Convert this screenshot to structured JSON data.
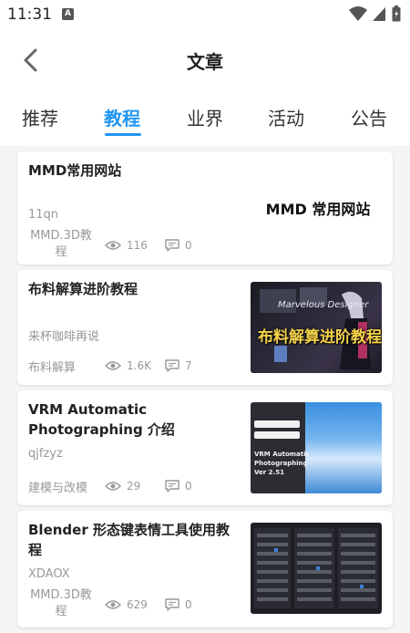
{
  "statusbar": {
    "time": "11:31",
    "notif_letter": "A"
  },
  "header": {
    "title": "文章"
  },
  "tabs": [
    {
      "label": "推荐"
    },
    {
      "label": "教程"
    },
    {
      "label": "业界"
    },
    {
      "label": "活动"
    },
    {
      "label": "公告"
    }
  ],
  "active_tab": "教程",
  "colors": {
    "accent": "#2196f3",
    "muted": "#999999"
  },
  "articles": [
    {
      "title": "MMD常用网站",
      "author": "11qn",
      "tag_line1": "MMD.3D教",
      "tag_line2": "程",
      "views": "116",
      "comments": "0",
      "thumb_text": "MMD 常用网站"
    },
    {
      "title": "布料解算进阶教程",
      "author": "来杯咖啡再说",
      "tag": "布料解算",
      "views": "1.6K",
      "comments": "7",
      "thumb_text": "布料解算进阶教程",
      "thumb_caption": "Marvelous Designer"
    },
    {
      "title": "VRM Automatic Photographing 介绍",
      "author": "qjfzyz",
      "tag": "建模与改模",
      "views": "29",
      "comments": "0",
      "thumb_text_1": "VRM Automatic",
      "thumb_text_2": "Photographing",
      "thumb_text_3": "Ver 2.51"
    },
    {
      "title": "Blender 形态键表情工具使用教程",
      "author": "XDAOX",
      "tag_line1": "MMD.3D教",
      "tag_line2": "程",
      "views": "629",
      "comments": "0"
    }
  ]
}
